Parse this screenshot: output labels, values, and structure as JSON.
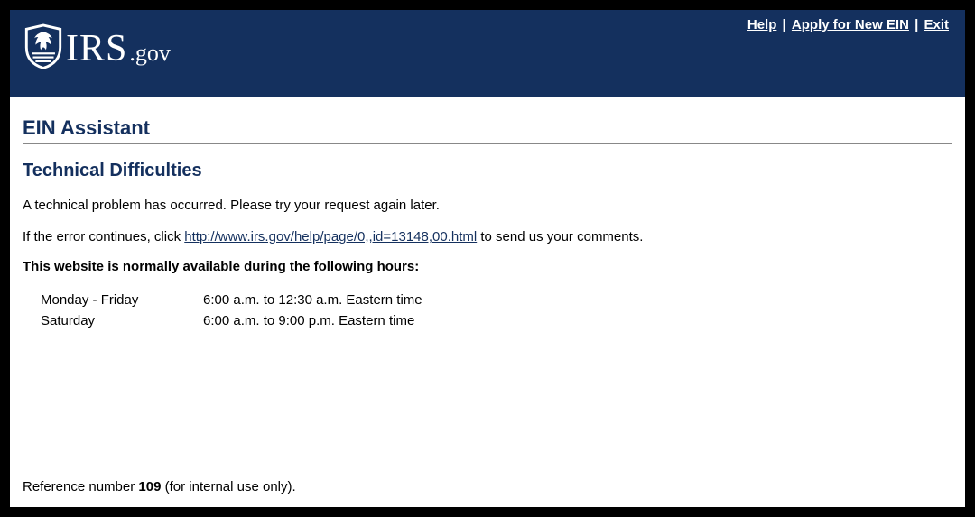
{
  "header": {
    "links": {
      "help": "Help",
      "apply": "Apply for New EIN",
      "exit": "Exit"
    },
    "logo": {
      "irs": "IRS",
      "gov": ".gov"
    }
  },
  "page": {
    "title": "EIN Assistant",
    "subtitle": "Technical Difficulties",
    "p1": "A technical problem has occurred. Please try your request again later.",
    "p2_pre": "If the error continues, click ",
    "p2_link": "http://www.irs.gov/help/page/0,,id=13148,00.html",
    "p2_post": " to send us your comments.",
    "hours_intro": "This website is normally available during the following hours:",
    "hours": [
      {
        "day": "Monday - Friday",
        "time": "6:00 a.m. to 12:30 a.m. Eastern time"
      },
      {
        "day": "Saturday",
        "time": "6:00 a.m. to 9:00 p.m. Eastern time"
      }
    ],
    "ref_pre": "Reference number ",
    "ref_num": "109",
    "ref_post": " (for internal use only)."
  }
}
